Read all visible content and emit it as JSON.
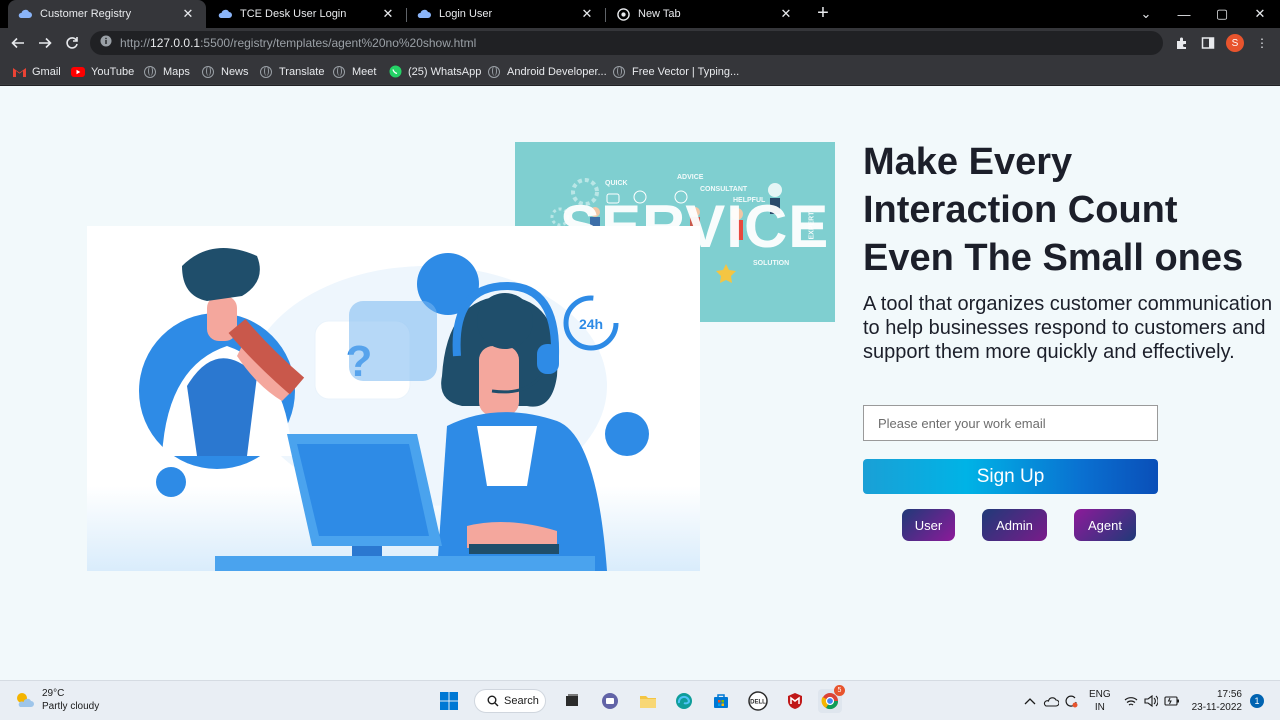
{
  "browser": {
    "tabs": [
      {
        "title": "Customer Registry",
        "active": true
      },
      {
        "title": "TCE Desk User Login",
        "active": false
      },
      {
        "title": "Login User",
        "active": false
      },
      {
        "title": "New Tab",
        "active": false
      }
    ],
    "address_bar": {
      "prefix": "http://",
      "host": "127.0.0.1",
      "rest": ":5500/registry/templates/agent%20no%20show.html"
    },
    "profile_initial": "S",
    "bookmarks": [
      "Gmail",
      "YouTube",
      "Maps",
      "News",
      "Translate",
      "Meet",
      "(25) WhatsApp",
      "Android Developer...",
      "Free Vector | Typing..."
    ]
  },
  "page": {
    "service_art": {
      "big_word": "SERVICE",
      "words": [
        "QUICK",
        "ADVICE",
        "CONSULTANT",
        "HELPFUL",
        "EXPERT",
        "SOLUTION"
      ]
    },
    "hero_badge": "24h",
    "headline": "Make Every Interaction Count Even The Small ones",
    "subline": "A tool that organizes customer communication to help businesses respond to customers and support them more quickly and effectively.",
    "email_placeholder": "Please enter your work email",
    "signup_label": "Sign Up",
    "roles": {
      "user": "User",
      "admin": "Admin",
      "agent": "Agent"
    }
  },
  "taskbar": {
    "weather_temp": "29°C",
    "weather_desc": "Partly cloudy",
    "search_label": "Search",
    "language": "ENG",
    "region": "IN",
    "time": "17:56",
    "date": "23-11-2022",
    "notification_count": "1",
    "chrome_badge": "5"
  },
  "colors": {
    "accent_blue": "#1a73e8",
    "page_bg": "#f2f9fb",
    "service_teal": "#7fcfd0",
    "headline": "#1c1f2a"
  }
}
